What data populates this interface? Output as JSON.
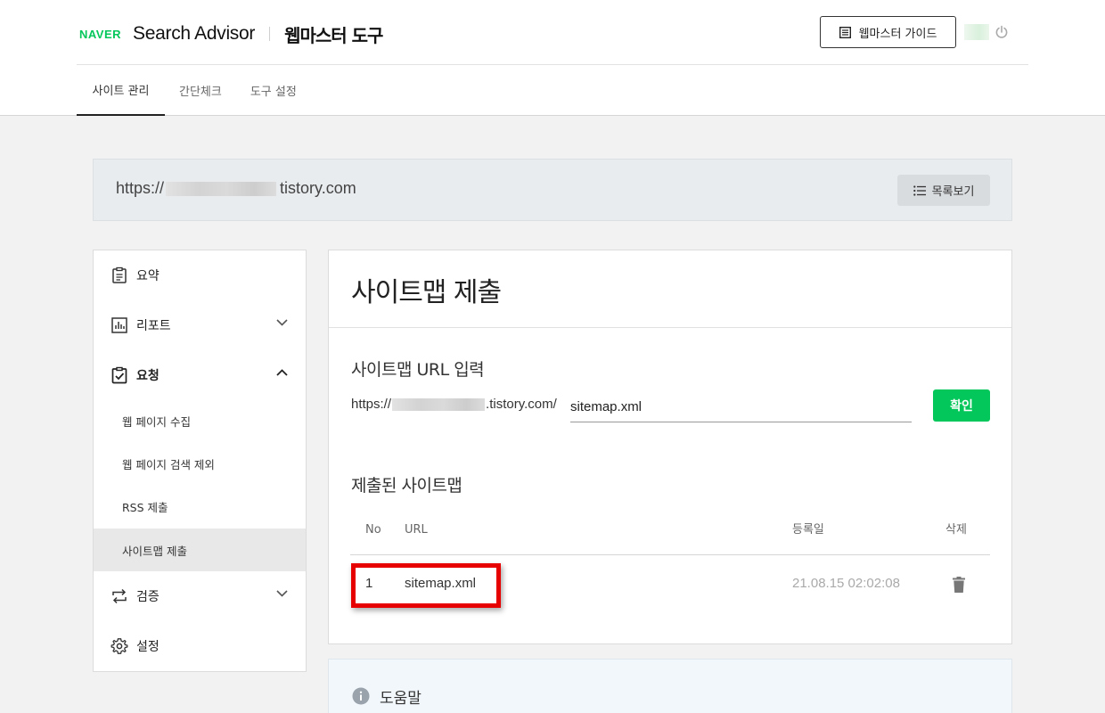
{
  "header": {
    "logo_naver": "NAVER",
    "logo_product": "Search Advisor",
    "tool_title": "웹마스터 도구",
    "guide_button": "웹마스터 가이드"
  },
  "tabs": [
    {
      "label": "사이트 관리",
      "active": true
    },
    {
      "label": "간단체크",
      "active": false
    },
    {
      "label": "도구 설정",
      "active": false
    }
  ],
  "site": {
    "url_prefix": "https://",
    "url_suffix": "tistory.com",
    "list_button": "목록보기"
  },
  "sidebar": {
    "items": [
      {
        "label": "요약",
        "icon": "clipboard-icon"
      },
      {
        "label": "리포트",
        "icon": "chart-icon",
        "expanded": false
      },
      {
        "label": "요청",
        "icon": "clipboard-check-icon",
        "expanded": true
      },
      {
        "label": "검증",
        "icon": "swap-arrows-icon",
        "expanded": false
      },
      {
        "label": "설정",
        "icon": "gear-icon"
      }
    ],
    "sub_items": [
      {
        "label": "웹 페이지 수집"
      },
      {
        "label": "웹 페이지 검색 제외"
      },
      {
        "label": "RSS 제출"
      },
      {
        "label": "사이트맵 제출",
        "active": true
      }
    ]
  },
  "main": {
    "title": "사이트맵 제출",
    "input_section_title": "사이트맵 URL 입력",
    "url_prefix": "https://",
    "url_suffix": ".tistory.com/",
    "input_value": "sitemap.xml",
    "confirm_button": "확인",
    "submitted_title": "제출된 사이트맵",
    "table": {
      "headers": {
        "no": "No",
        "url": "URL",
        "date": "등록일",
        "delete": "삭제"
      },
      "rows": [
        {
          "no": "1",
          "url": "sitemap.xml",
          "date": "21.08.15 02:02:08"
        }
      ]
    }
  },
  "help": {
    "title": "도움말"
  },
  "colors": {
    "brand_green": "#03c75a",
    "highlight_red": "#e60000"
  }
}
